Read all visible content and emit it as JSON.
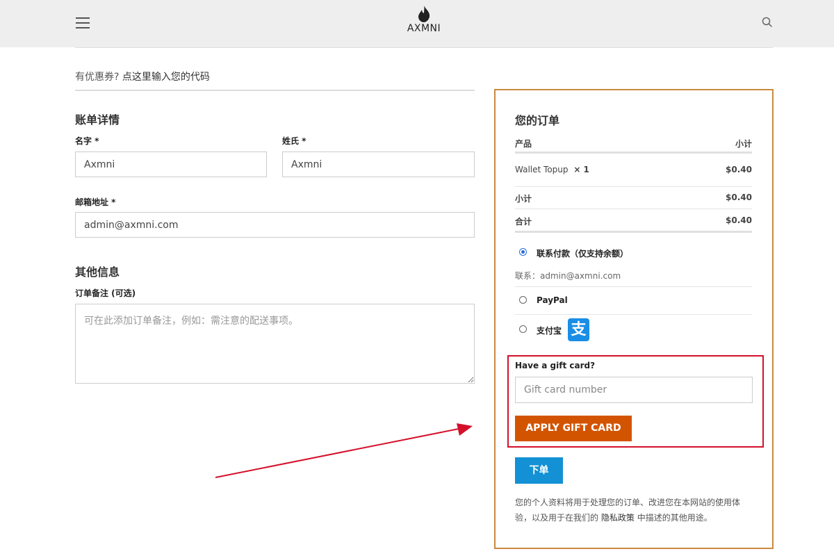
{
  "header": {
    "logo_text": "AXMNI"
  },
  "coupon": {
    "prompt": "有优惠券?",
    "link": "点这里输入您的代码"
  },
  "billing": {
    "title": "账单详情",
    "first_name_label": "名字 *",
    "first_name_value": "Axmni",
    "last_name_label": "姓氏 *",
    "last_name_value": "Axmni",
    "email_label": "邮箱地址 *",
    "email_value": "admin@axmni.com"
  },
  "additional": {
    "title": "其他信息",
    "notes_label": "订单备注 (可选)",
    "notes_placeholder": "可在此添加订单备注，例如：需注意的配送事项。"
  },
  "order": {
    "title": "您的订单",
    "col_product": "产品",
    "col_subtotal": "小计",
    "item_name": "Wallet Topup",
    "item_qty": "× 1",
    "item_price": "$0.40",
    "subtotal_label": "小计",
    "subtotal_value": "$0.40",
    "total_label": "合计",
    "total_value": "$0.40"
  },
  "payment": {
    "option1_label": "联系付款（仅支持余额）",
    "option1_desc": "联系：admin@axmni.com",
    "option2_label": "PayPal",
    "option3_label": "支付宝",
    "alipay_glyph": "支"
  },
  "gift": {
    "label": "Have a gift card?",
    "placeholder": "Gift card number",
    "button": "APPLY GIFT CARD"
  },
  "place_order": "下单",
  "privacy": {
    "text_before": "您的个人资料将用于处理您的订单、改进您在本网站的使用体验，以及用于在我们的",
    "link": "隐私政策",
    "text_after": "中描述的其他用途。"
  },
  "colors": {
    "header_bg": "#eeeeee",
    "order_border": "#c98a3f",
    "gift_highlight": "#d4102a",
    "gift_button": "#d35400",
    "order_button": "#1391d4",
    "annotation_arrow": "#d4102a"
  }
}
